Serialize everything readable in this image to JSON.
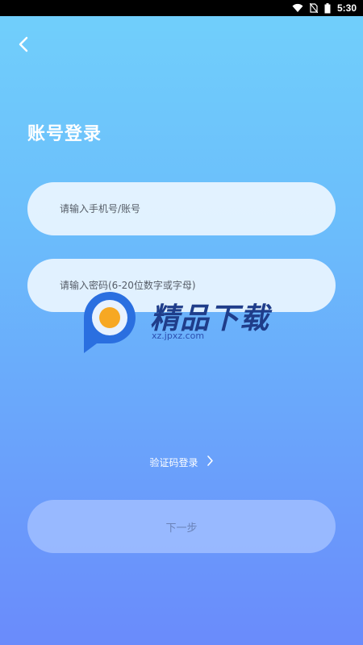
{
  "status_bar": {
    "time": "5:30",
    "icons": [
      "wifi-icon",
      "no-sim-icon",
      "battery-icon"
    ]
  },
  "header": {
    "back_icon": "chevron-left-icon"
  },
  "title": "账号登录",
  "form": {
    "account_placeholder": "请输入手机号/账号",
    "password_placeholder": "请输入密码(6-20位数字或字母)"
  },
  "watermark": {
    "text": "精品下载",
    "subtext": "xz.jpxz.com"
  },
  "code_login": {
    "label": "验证码登录",
    "icon": "chevron-right-icon"
  },
  "next_button": {
    "label": "下一步"
  },
  "colors": {
    "background_top": "#71d0fb",
    "background_bottom": "#6a8bfb",
    "field_bg": "#ebf5ff",
    "button_bg": "#a0beff"
  }
}
